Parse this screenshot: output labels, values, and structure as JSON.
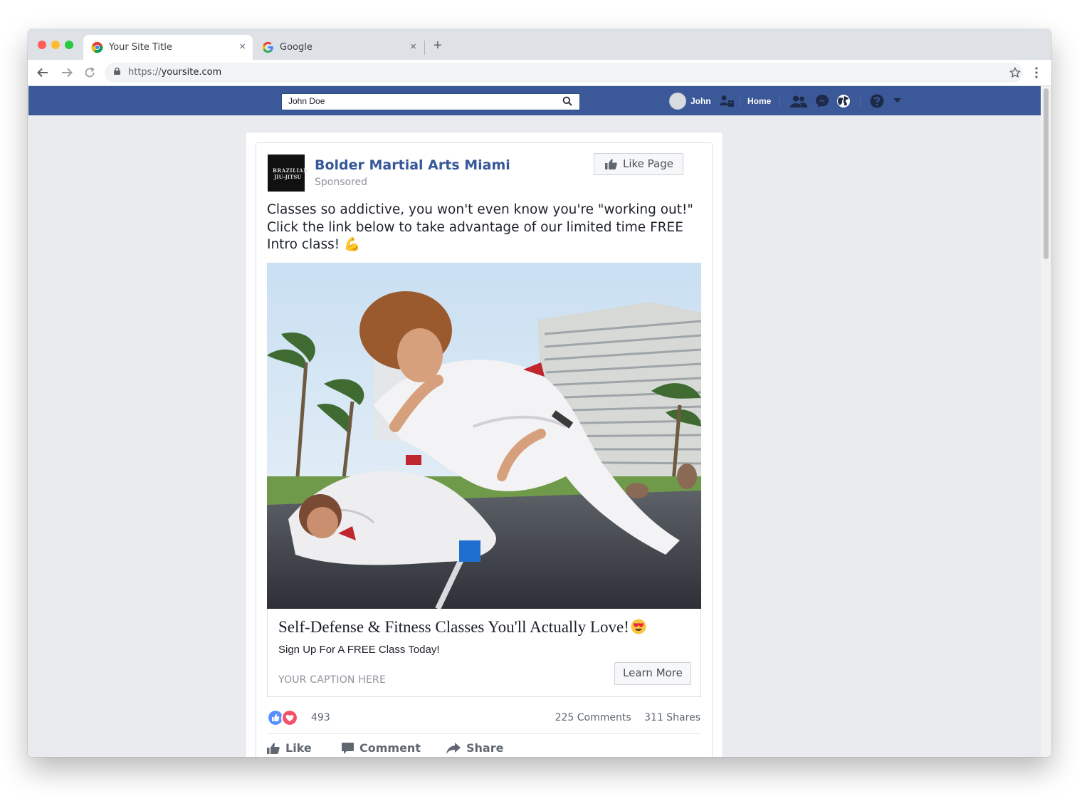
{
  "browser": {
    "tabs": [
      {
        "title": "Your Site Title",
        "close": "×"
      },
      {
        "title": "Google",
        "close": "×"
      }
    ],
    "new_tab": "+",
    "url_scheme": "https://",
    "url_host": "yoursite.com"
  },
  "fb": {
    "search_value": "John Doe",
    "user_name": "John",
    "home_label": "Home"
  },
  "post": {
    "page_name": "Bolder Martial Arts Miami",
    "sponsored": "Sponsored",
    "avatar_text_1": "BRAZILIAN",
    "avatar_text_2": "JIU-JITSU",
    "like_page_label": "Like Page",
    "text_line_1": "Classes so addictive, you won't even know you're \"working out!\"",
    "text_line_2": "Click the link below to take advantage of our limited time FREE Intro class! 💪",
    "headline": "Self-Defense & Fitness Classes You'll Actually Love!",
    "subline": "Sign Up For A FREE Class Today!",
    "caption": "YOUR CAPTION HERE",
    "cta_label": "Learn More",
    "reaction_count": "493",
    "comments": "225 Comments",
    "shares": "311 Shares",
    "actions": {
      "like": "Like",
      "comment": "Comment",
      "share": "Share"
    }
  },
  "colors": {
    "fb_blue": "#3b5998",
    "link_blue": "#365899",
    "like_blue": "#5890ff",
    "love_red": "#f25268"
  }
}
